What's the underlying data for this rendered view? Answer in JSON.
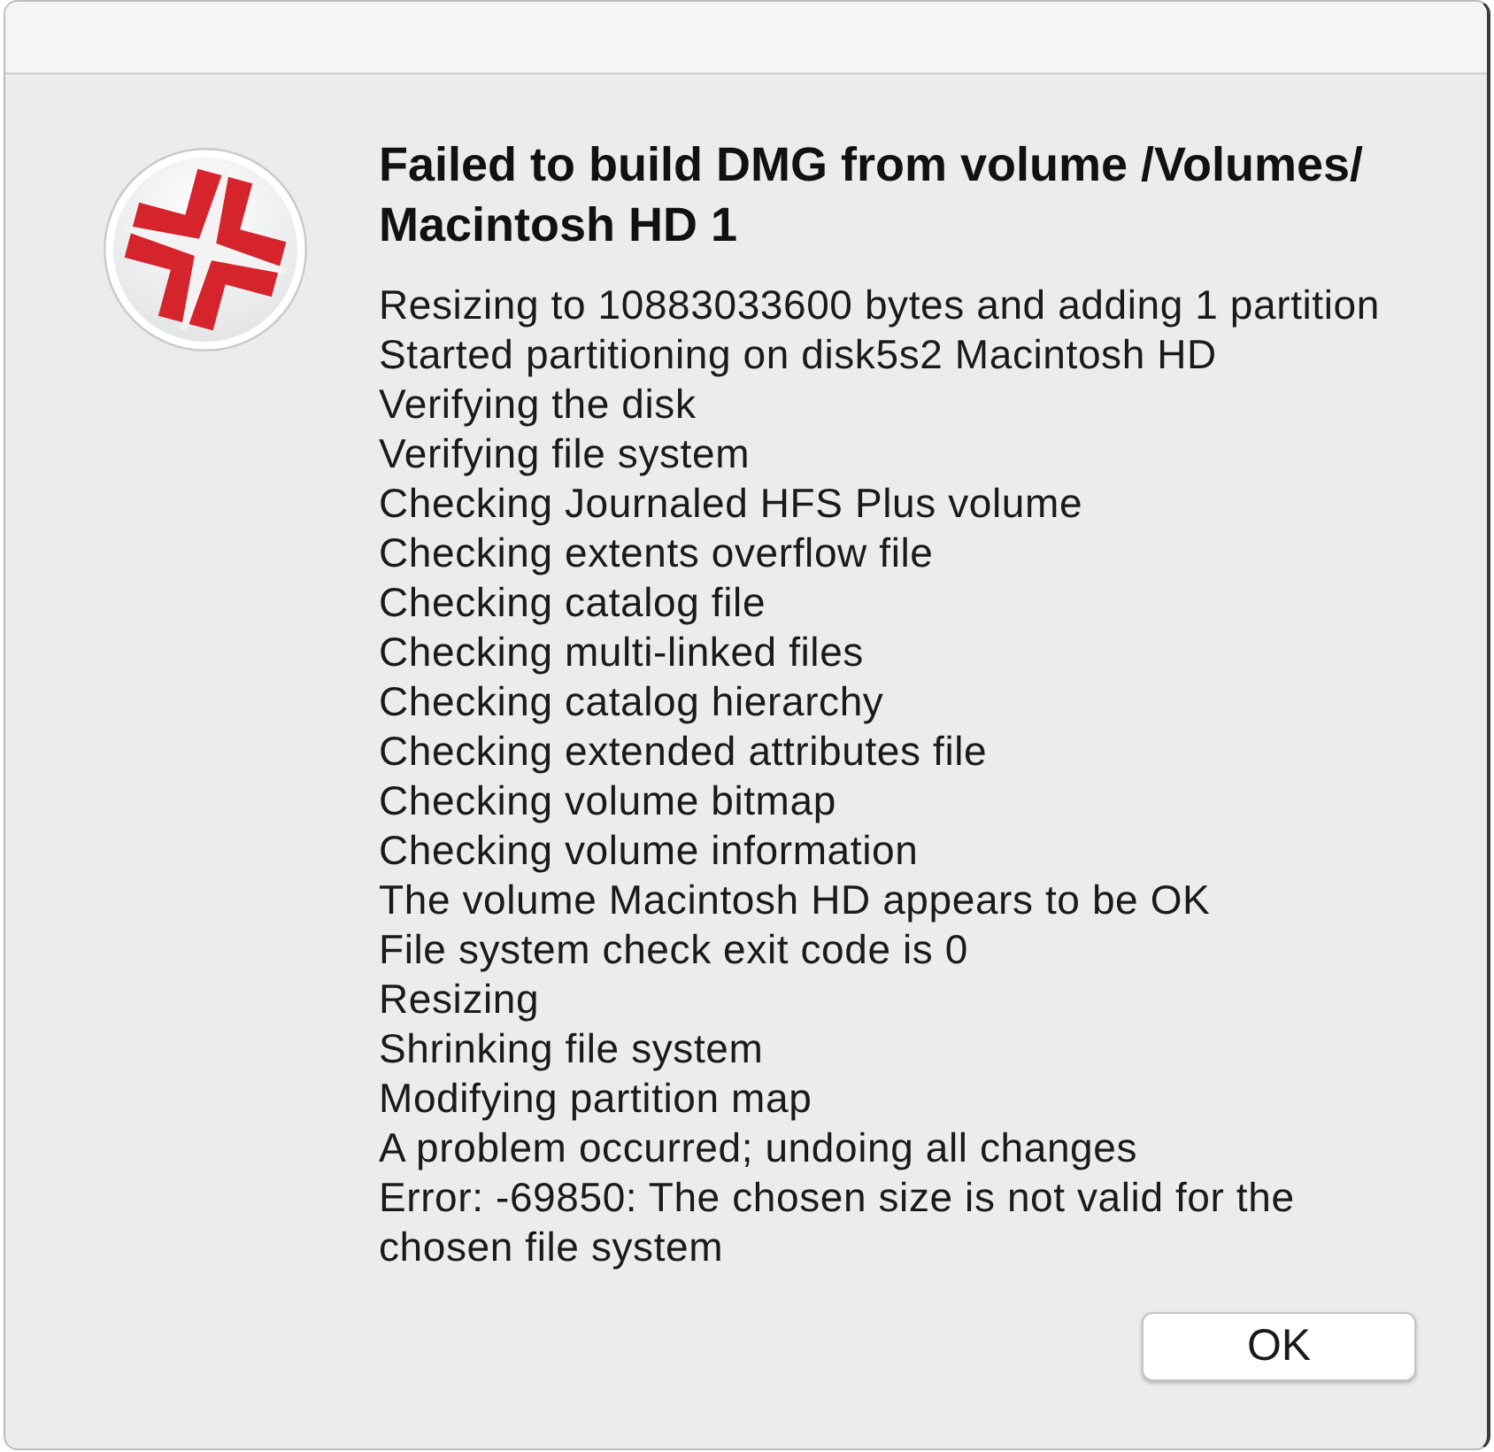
{
  "dialog": {
    "title": "Failed to build DMG from volume /Volumes/ Macintosh HD 1",
    "message_lines": [
      "Resizing to 10883033600 bytes and adding 1 partition",
      "Started partitioning on disk5s2 Macintosh HD",
      "Verifying the disk",
      "Verifying file system",
      "Checking Journaled HFS Plus volume",
      "Checking extents overflow file",
      "Checking catalog file",
      "Checking multi-linked files",
      "Checking catalog hierarchy",
      "Checking extended attributes file",
      "Checking volume bitmap",
      "Checking volume information",
      "The volume Macintosh HD appears to be OK",
      "File system check exit code is 0",
      "Resizing",
      "Shrinking file system",
      "Modifying partition map",
      "A problem occurred; undoing all changes",
      "Error: -69850: The chosen size is not valid for the chosen file system"
    ],
    "buttons": [
      {
        "label": "OK"
      }
    ]
  }
}
